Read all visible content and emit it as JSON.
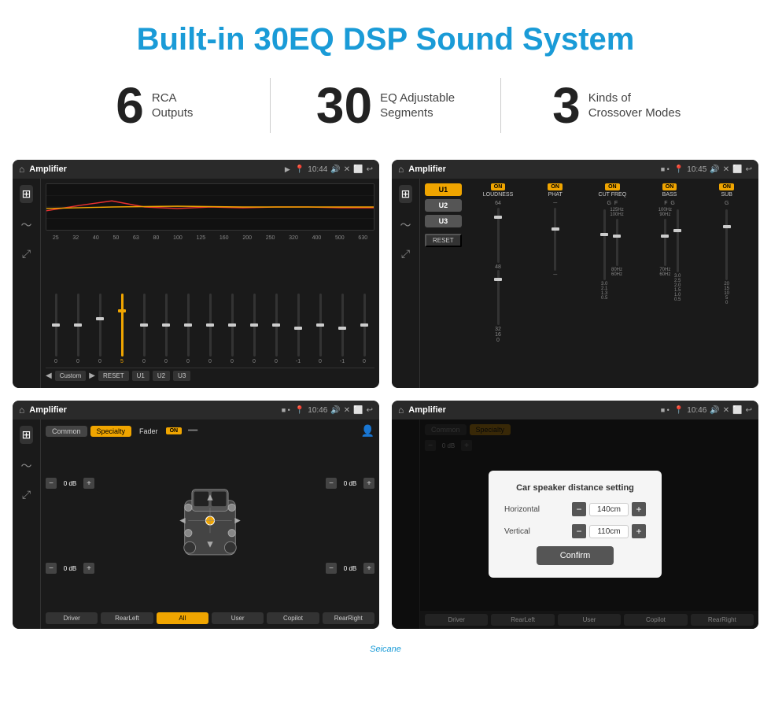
{
  "header": {
    "title": "Built-in 30EQ DSP Sound System",
    "title_color": "#1a9bd7"
  },
  "stats": [
    {
      "number": "6",
      "label": "RCA\nOutputs"
    },
    {
      "number": "30",
      "label": "EQ Adjustable\nSegments"
    },
    {
      "number": "3",
      "label": "Kinds of\nCrossover Modes"
    }
  ],
  "screens": [
    {
      "id": "screen1",
      "header": {
        "title": "Amplifier",
        "time": "10:44"
      },
      "eq_freqs": [
        "25",
        "32",
        "40",
        "50",
        "63",
        "80",
        "100",
        "125",
        "160",
        "200",
        "250",
        "320",
        "400",
        "500",
        "630"
      ],
      "eq_values": [
        "0",
        "0",
        "0",
        "5",
        "0",
        "0",
        "0",
        "0",
        "0",
        "0",
        "0",
        "-1",
        "0",
        "-1",
        "0"
      ],
      "bottom_buttons": [
        "Custom",
        "RESET",
        "U1",
        "U2",
        "U3"
      ]
    },
    {
      "id": "screen2",
      "header": {
        "title": "Amplifier",
        "time": "10:45"
      },
      "presets": [
        "U1",
        "U2",
        "U3"
      ],
      "controls": [
        {
          "label": "LOUDNESS",
          "on": true
        },
        {
          "label": "PHAT",
          "on": true
        },
        {
          "label": "CUT FREQ",
          "on": true
        },
        {
          "label": "BASS",
          "on": true
        },
        {
          "label": "SUB",
          "on": true
        }
      ],
      "reset_label": "RESET"
    },
    {
      "id": "screen3",
      "header": {
        "title": "Amplifier",
        "time": "10:46"
      },
      "tabs": [
        "Common",
        "Specialty"
      ],
      "active_tab": "Specialty",
      "fader_label": "Fader",
      "db_controls": [
        {
          "label": "0 dB"
        },
        {
          "label": "0 dB"
        },
        {
          "label": "0 dB"
        },
        {
          "label": "0 dB"
        }
      ],
      "bottom_buttons": [
        "Driver",
        "RearLeft",
        "All",
        "User",
        "Copilot",
        "RearRight"
      ],
      "active_button": "All"
    },
    {
      "id": "screen4",
      "header": {
        "title": "Amplifier",
        "time": "10:46"
      },
      "dialog": {
        "title": "Car speaker distance setting",
        "rows": [
          {
            "label": "Horizontal",
            "value": "140cm"
          },
          {
            "label": "Vertical",
            "value": "110cm"
          }
        ],
        "confirm_label": "Confirm"
      },
      "bottom_buttons": [
        "Driver",
        "RearLeft",
        "User",
        "Copilot",
        "RearRight"
      ]
    }
  ],
  "watermark": "Seicane"
}
